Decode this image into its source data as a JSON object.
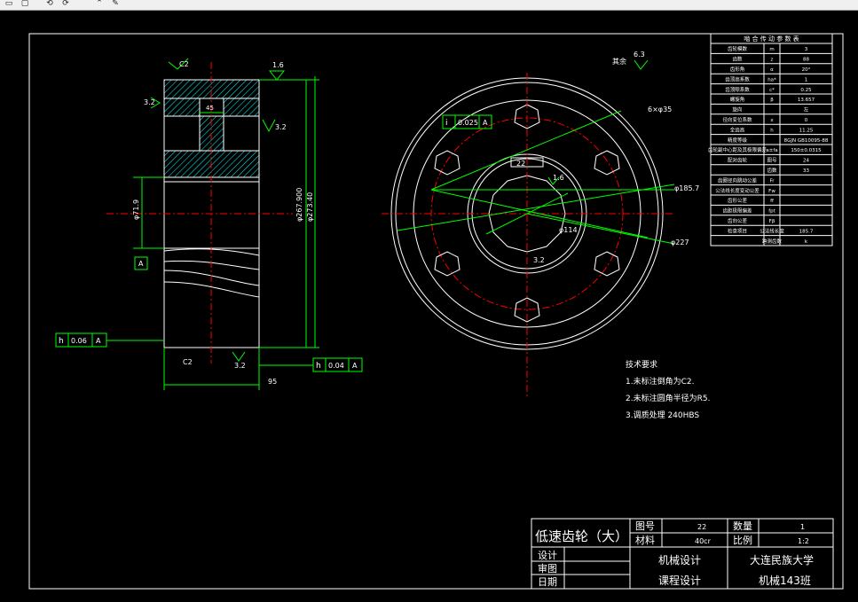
{
  "colors": {
    "background": "#000000",
    "outline": "#ffffff",
    "dimension": "#00ff00",
    "center_line": "#ff0000",
    "hatch": "#00ffff"
  },
  "toolbar": {
    "icons": [
      "open-icon",
      "save-icon",
      "undo-icon",
      "redo-icon",
      "pointer-icon",
      "brush-icon"
    ]
  },
  "dimensions": {
    "chamfer_top": "C2",
    "chamfer_bottom": "C2",
    "roughness_top": "1.6",
    "roughness_right": "3.2",
    "roughness_mid": "3.2",
    "roughness_left": "3.2",
    "roughness_bottom": "3.2",
    "roughness_other": "6.3",
    "roughness_other_label": "其余",
    "hub_width": "45",
    "face_width": "95",
    "bore": "φ71.9",
    "outer_dia_1": "φ267.900",
    "outer_dia_2": "φ273.40",
    "datum_label": "A",
    "tol_left": {
      "symbol": "h",
      "value": "0.06",
      "datum": "A"
    },
    "tol_right": {
      "symbol": "h",
      "value": "0.04",
      "datum": "A"
    },
    "tol_center": {
      "symbol": "i",
      "value": "0.025",
      "datum": "A"
    },
    "hole_dia": "6×φ35",
    "dia_pitch": "φ185.7",
    "dia_outer": "φ227",
    "dia_hub": "φ114",
    "keyway": "22",
    "roughness_hub": "1.6",
    "roughness_key": "3.2"
  },
  "params_table": {
    "header": "啮 合 传 动 参 数 表",
    "rows": [
      [
        "齿轮模数",
        "m",
        "3"
      ],
      [
        "齿数",
        "z",
        "88"
      ],
      [
        "齿形角",
        "α",
        "20°"
      ],
      [
        "齿顶高系数",
        "ha*",
        "1"
      ],
      [
        "齿顶隙系数",
        "c*",
        "0.25"
      ],
      [
        "螺旋角",
        "β",
        "13.657"
      ],
      [
        "旋向",
        "",
        "左"
      ],
      [
        "径向变位系数",
        "x",
        "0"
      ],
      [
        "全齿高",
        "h",
        "11.25"
      ],
      [
        "精度等级",
        "",
        "8GJN GB10095-88"
      ]
    ],
    "extra_rows": [
      [
        "齿轮副中心距及其极限偏差",
        "a±fa",
        "150±0.0315"
      ],
      [
        "配对齿轮",
        "图号",
        "24"
      ],
      [
        "",
        "齿数",
        "33"
      ],
      [
        "齿圈径向跳动公差",
        "Fr",
        ""
      ],
      [
        "公法线长度变动公差",
        "Fw",
        ""
      ],
      [
        "齿形公差",
        "ff",
        ""
      ],
      [
        "齿距极限偏差",
        "fpt",
        ""
      ],
      [
        "齿向公差",
        "Fβ",
        ""
      ],
      [
        "检查项目",
        "公法线长度",
        "185.7"
      ],
      [
        "",
        "跨测齿数",
        "k"
      ]
    ]
  },
  "tech_requirements": {
    "title": "技术要求",
    "items": [
      "1.未标注倒角为C2.",
      "2.未标注圆角半径为R5.",
      "3.调质处理 240HBS"
    ]
  },
  "title_block": {
    "part_name": "低速齿轮（大）",
    "drawing_no_label": "图号",
    "drawing_no": "22",
    "material_label": "材料",
    "material": "40cr",
    "qty_label": "数量",
    "qty": "1",
    "scale_label": "比例",
    "scale": "1:2",
    "design": "设计",
    "draw": "审图",
    "date": "日期",
    "course1": "机械设计",
    "course2": "课程设计",
    "school": "大连民族大学",
    "klass": "机械143班"
  }
}
